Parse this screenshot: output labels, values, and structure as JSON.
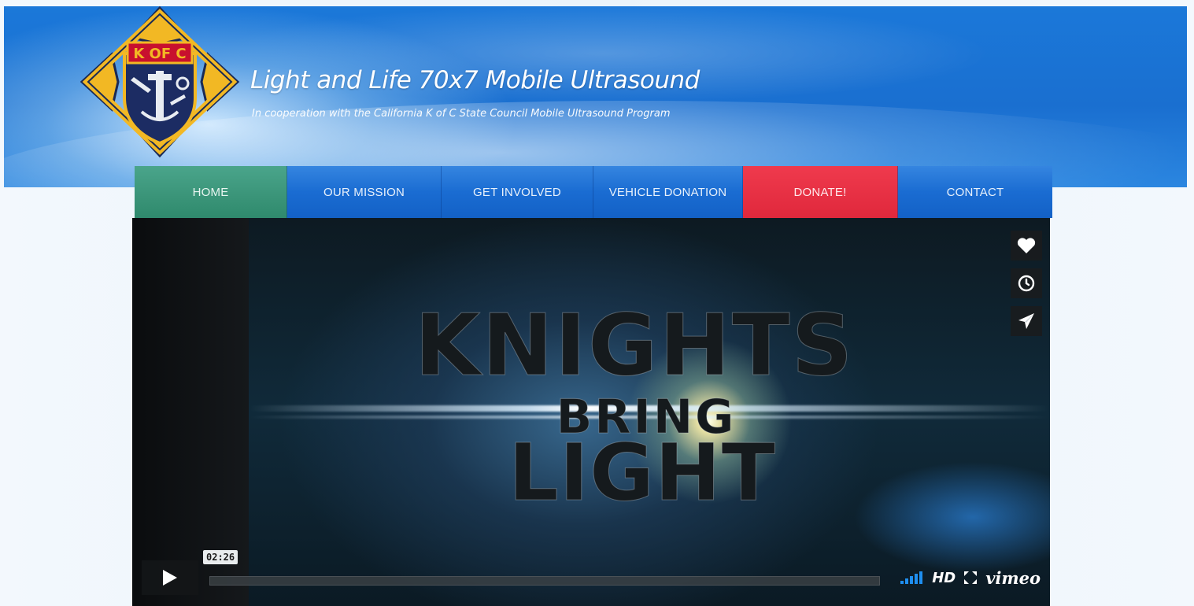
{
  "header": {
    "logo_text": "K OF C",
    "title": "Light and Life 70x7 Mobile Ultrasound",
    "subtitle": "In cooperation with the California K of C State Council Mobile Ultrasound Program"
  },
  "nav": {
    "items": [
      {
        "label": "HOME",
        "active": true
      },
      {
        "label": "OUR MISSION"
      },
      {
        "label": "GET INVOLVED"
      },
      {
        "label": "VEHICLE DONATION"
      },
      {
        "label": "DONATE!"
      },
      {
        "label": "CONTACT"
      }
    ]
  },
  "video": {
    "title_lines": [
      "KNIGHTS",
      "BRING",
      "LIGHT"
    ],
    "timecode": "02:26",
    "hd_label": "HD",
    "brand": "vimeo",
    "side_icons": [
      "heart-icon",
      "clock-icon",
      "send-icon"
    ]
  },
  "colors": {
    "banner_blue": "#1a6fd0",
    "nav_blue": "#1a6cd2",
    "nav_home_green": "#3a9478",
    "nav_donate_red": "#e0283c",
    "logo_gold": "#f2b824",
    "signal_blue": "#1e8ff0"
  }
}
